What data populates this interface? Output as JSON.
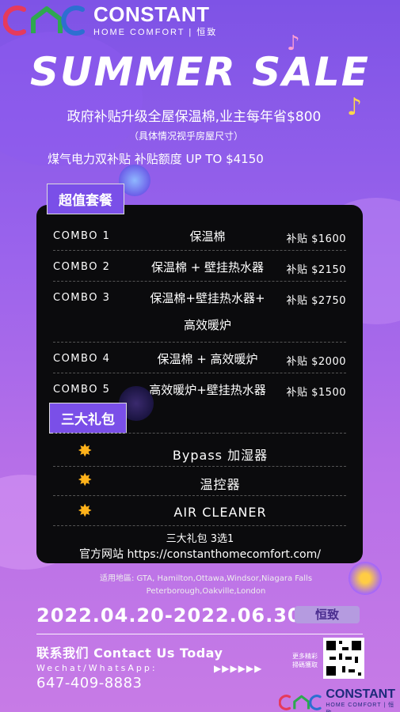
{
  "brand": {
    "name": "CONSTANT",
    "subtitle": "HOME COMFORT | 恒致"
  },
  "title": "SUMMER SALE",
  "subtitle_main": "政府补贴升级全屋保温棉,业主每年省$800",
  "subtitle_note": "（具体情况视乎房屋尺寸）",
  "subsidy_line": "煤气电力双补贴  补贴额度 UP TO $4150",
  "combo_section_label": "超值套餐",
  "combos": [
    {
      "label": "COMBO 1",
      "item": "保温棉",
      "price": "补贴 $1600"
    },
    {
      "label": "COMBO 2",
      "item": "保温棉 + 壁挂热水器",
      "price": "补贴 $2150"
    },
    {
      "label": "COMBO 3",
      "item": "保温棉+壁挂热水器+",
      "item2": "高效暖炉",
      "price": "补贴 $2750"
    },
    {
      "label": "COMBO 4",
      "item": "保温棉 + 高效暖炉",
      "price": "补贴 $2000"
    },
    {
      "label": "COMBO 5",
      "item": "高效暖炉+壁挂热水器",
      "price": "补贴 $1500"
    }
  ],
  "gift_section_label": "三大礼包",
  "gifts": [
    {
      "text": "Bypass 加湿器"
    },
    {
      "text": "温控器"
    },
    {
      "text": "AIR CLEANER"
    }
  ],
  "gift_pick": "三大礼包 3选1",
  "website": "官方网站 https://constanthomecomfort.com/",
  "service_area_line1": "适用地區: GTA, Hamilton,Ottawa,Windsor,Niagara Falls",
  "service_area_line2": "Peterborough,Oakville,London",
  "date_range": "2022.04.20-2022.06.30",
  "brand_pill": "恒致",
  "contact_heading": "联系我们 Contact Us Today",
  "wechat_label": "Wechat/WhatsApp:",
  "phone": "647-409-8883",
  "arrows": "▶▶▶▶▶▶",
  "qr_caption": "更多精彩 掃碼獲取",
  "colors": {
    "accent_purple": "#7a4fe8",
    "panel_black": "#0b0b0d",
    "sun_orange": "#ffb21a",
    "brand_navy": "#1d2a7a"
  }
}
